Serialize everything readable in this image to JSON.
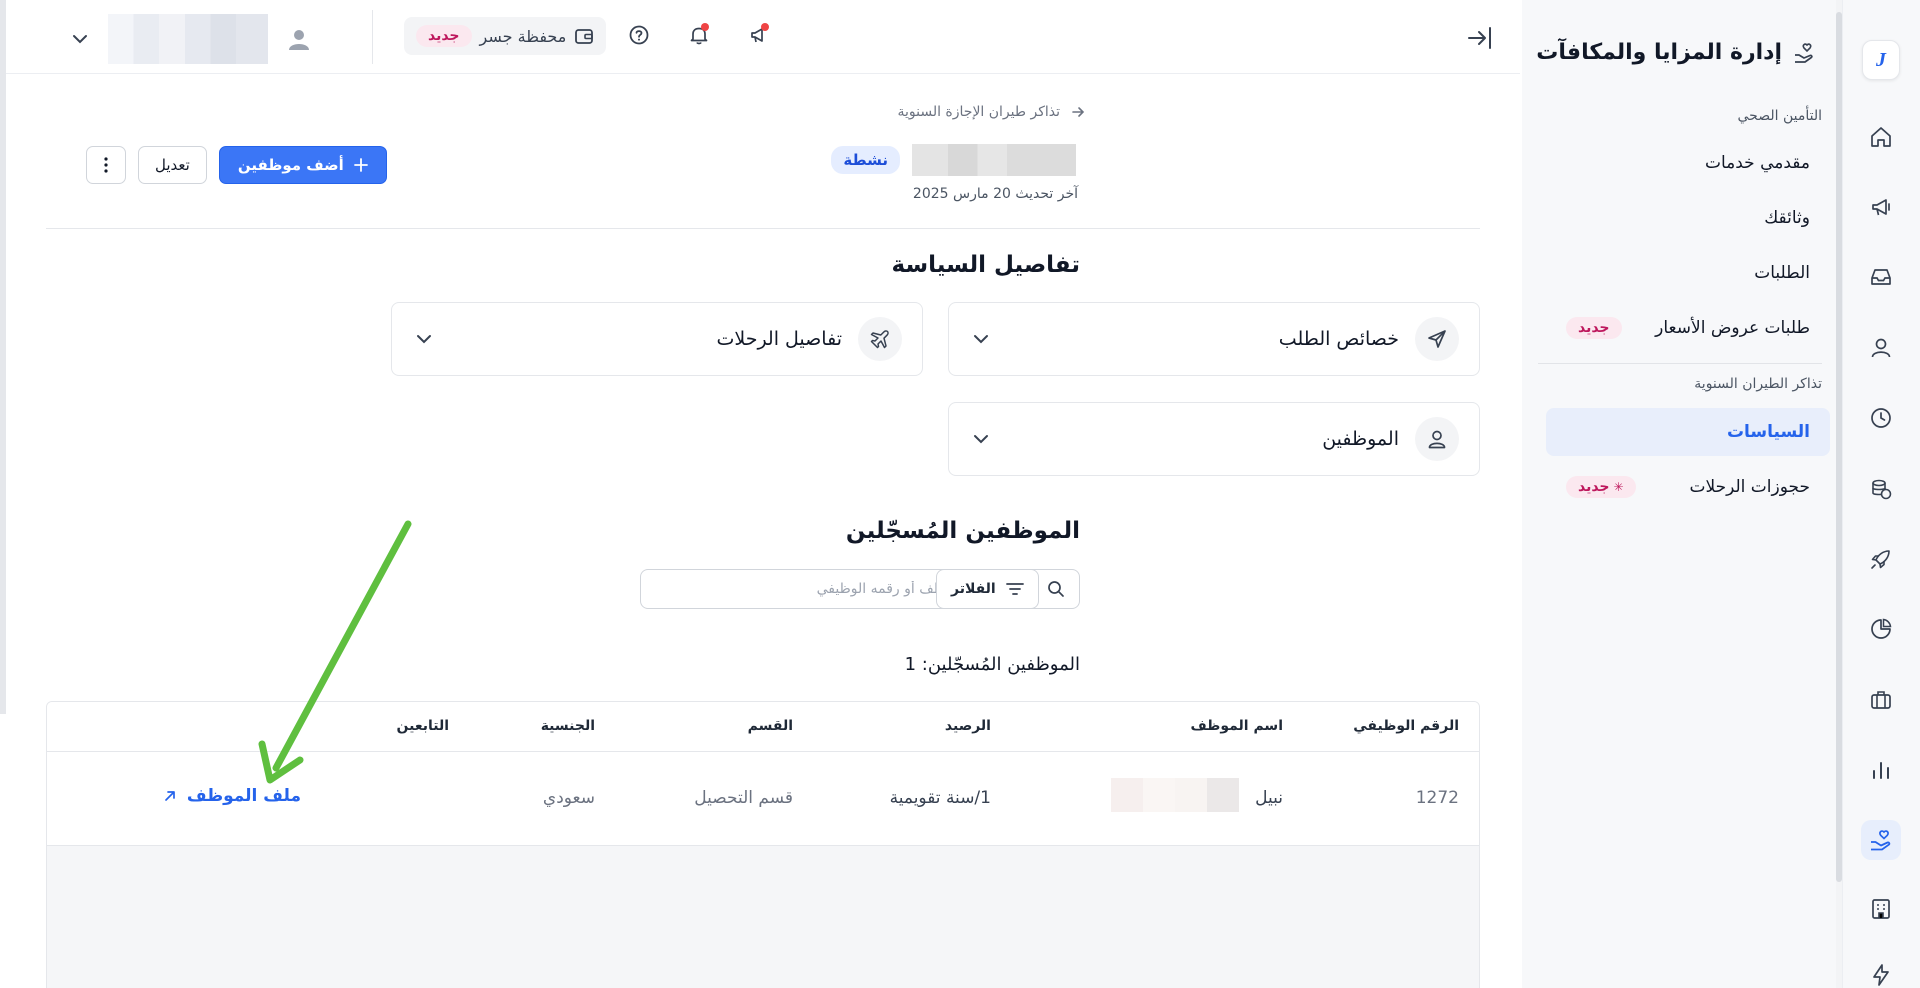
{
  "rail": {
    "logo_letter": "J",
    "icons": [
      "home-icon",
      "megaphone-icon",
      "inbox-icon",
      "person-icon",
      "clock-icon",
      "coins-icon",
      "rocket-icon",
      "pie-chart-icon",
      "briefcase-icon",
      "bar-chart-icon",
      "benefits-hand-icon",
      "building-icon",
      "lightning-icon"
    ],
    "active_icon": "benefits-hand-icon"
  },
  "sidenav": {
    "title": "إدارة المزايا والمكافآت",
    "section1_label": "التأمين الصحي",
    "section1_items": [
      {
        "label": "مقدمي خدمات"
      },
      {
        "label": "وثائقك"
      },
      {
        "label": "الطلبات"
      },
      {
        "label": "طلبات عروض الأسعار",
        "badge": "جديد"
      }
    ],
    "section2_label": "تذاكر الطيران السنوية",
    "section2_items": [
      {
        "label": "السياسات",
        "active": true
      },
      {
        "label": "حجوزات الرحلات",
        "badge": "جديد"
      }
    ]
  },
  "topbar": {
    "wallet_label": "محفظة جسر",
    "wallet_badge": "جديد"
  },
  "breadcrumb": {
    "label": "تذاكر طيران الإجازة السنوية"
  },
  "page": {
    "status": "نشطة",
    "updated": "آخر تحديث 20 مارس 2025",
    "add_button": "أضف موظفين",
    "edit_button": "تعديل"
  },
  "policy_details": {
    "heading": "تفاصيل السياسة",
    "request_props": "خصائص الطلب",
    "trip_details": "تفاصيل الرحلات",
    "employees": "الموظفين"
  },
  "enrolled": {
    "heading": "الموظفين المُسجّلين",
    "search_placeholder": "ابحث باسم الموظف أو رقمه الوظيفي",
    "filter_label": "الفلاتر",
    "count_label": "الموظفين المُسجّلين: 1",
    "columns": {
      "emp_id": "الرقم الوظيفي",
      "name": "اسم الموظف",
      "balance": "الرصيد",
      "department": "القسم",
      "nationality": "الجنسية",
      "dependents": "التابعين"
    },
    "rows": [
      {
        "emp_id": "1272",
        "name": "نبيل",
        "balance": "1/سنة تقويمية",
        "department": "قسم التحصيل",
        "nationality": "سعودي",
        "dependents": "",
        "profile_link": "ملف الموظف"
      }
    ]
  },
  "colors": {
    "accent": "#3b76f6",
    "annotation_arrow": "#5fbf3f",
    "badge_pink": "#be185d"
  }
}
